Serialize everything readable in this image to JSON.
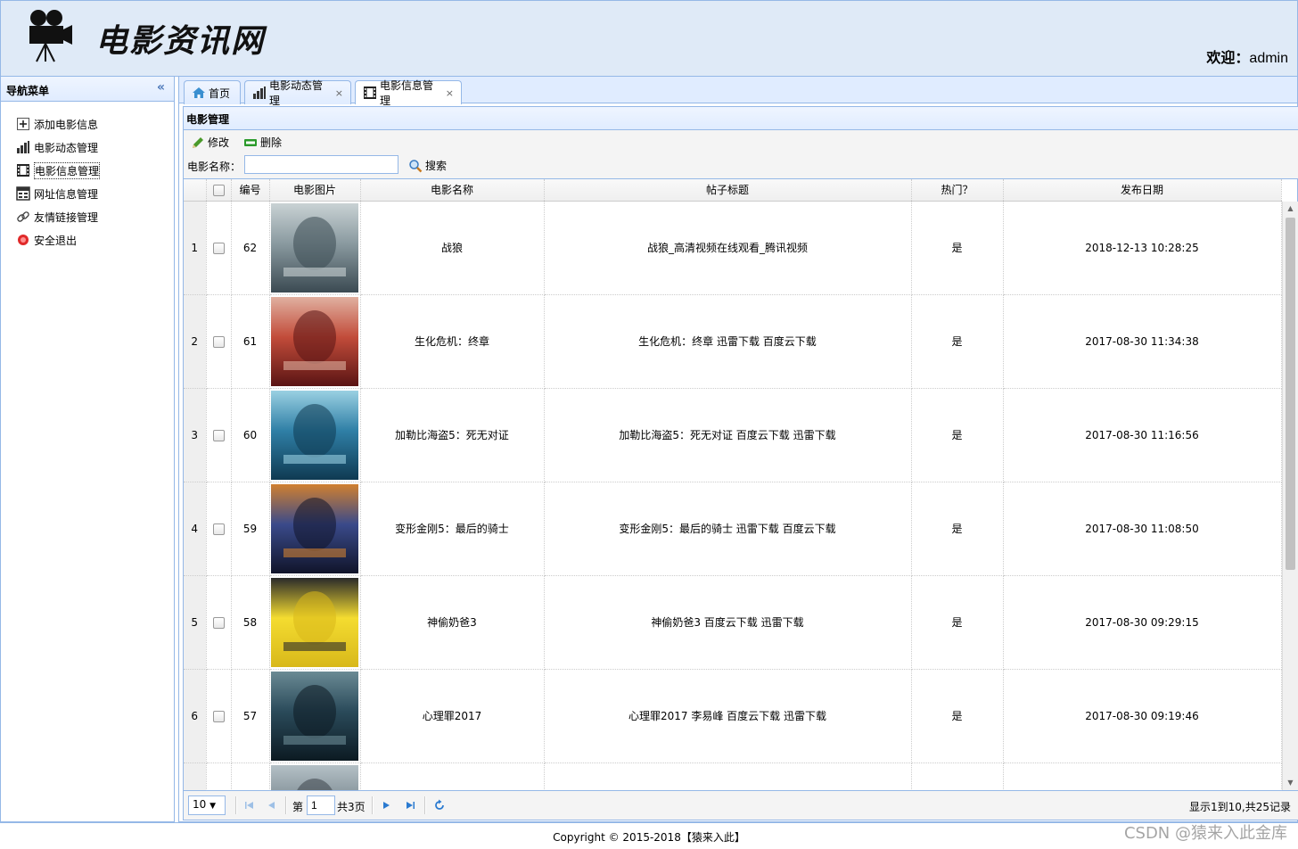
{
  "header": {
    "site_title": "电影资讯网",
    "welcome_label": "欢迎：",
    "username": "admin"
  },
  "sidebar": {
    "title": "导航菜单",
    "items": [
      {
        "label": "添加电影信息",
        "icon": "add-icon"
      },
      {
        "label": "电影动态管理",
        "icon": "bar-chart-icon"
      },
      {
        "label": "电影信息管理",
        "icon": "film-icon",
        "active": true
      },
      {
        "label": "网址信息管理",
        "icon": "window-icon"
      },
      {
        "label": "友情链接管理",
        "icon": "link-icon"
      },
      {
        "label": "安全退出",
        "icon": "exit-icon"
      }
    ]
  },
  "tabs": [
    {
      "label": "首页",
      "icon": "home-icon",
      "closable": false
    },
    {
      "label": "电影动态管理",
      "icon": "bar-chart-icon",
      "closable": true
    },
    {
      "label": "电影信息管理",
      "icon": "film-icon",
      "closable": true,
      "active": true
    }
  ],
  "panel": {
    "title": "电影管理",
    "edit_label": "修改",
    "delete_label": "删除",
    "search_label": "电影名称：",
    "search_value": "",
    "search_button": "搜索"
  },
  "grid": {
    "columns": [
      "编号",
      "电影图片",
      "电影名称",
      "帖子标题",
      "热门？",
      "发布日期"
    ],
    "rows": [
      {
        "rownum": "1",
        "id": "62",
        "name": "战狼",
        "title": "战狼_高清视频在线观看_腾讯视频",
        "hot": "是",
        "date": "2018-12-13 10:28:25",
        "poster": [
          "#3b4a52",
          "#8a9aa0",
          "#c9d2d4"
        ]
      },
      {
        "rownum": "2",
        "id": "61",
        "name": "生化危机：终章",
        "title": "生化危机：终章 迅雷下载 百度云下载",
        "hot": "是",
        "date": "2017-08-30 11:34:38",
        "poster": [
          "#5a1414",
          "#c24c3a",
          "#e0b0a0"
        ]
      },
      {
        "rownum": "3",
        "id": "60",
        "name": "加勒比海盗5：死无对证",
        "title": "加勒比海盗5：死无对证 百度云下载 迅雷下载",
        "hot": "是",
        "date": "2017-08-30 11:16:56",
        "poster": [
          "#0f3a52",
          "#2f7fa6",
          "#9ad0e2"
        ]
      },
      {
        "rownum": "4",
        "id": "59",
        "name": "变形金刚5：最后的骑士",
        "title": "变形金刚5：最后的骑士 迅雷下载 百度云下载",
        "hot": "是",
        "date": "2017-08-30 11:08:50",
        "poster": [
          "#10142a",
          "#3a4a8a",
          "#d08030"
        ]
      },
      {
        "rownum": "5",
        "id": "58",
        "name": "神偷奶爸3",
        "title": "神偷奶爸3 百度云下载 迅雷下载",
        "hot": "是",
        "date": "2017-08-30 09:29:15",
        "poster": [
          "#d8b81a",
          "#f4dc30",
          "#2a2a2a"
        ]
      },
      {
        "rownum": "6",
        "id": "57",
        "name": "心理罪2017",
        "title": "心理罪2017 李易峰 百度云下载 迅雷下载",
        "hot": "是",
        "date": "2017-08-30 09:19:46",
        "poster": [
          "#0c1a22",
          "#2a4a5a",
          "#6a8a94"
        ]
      },
      {
        "rownum": "",
        "id": "",
        "name": "",
        "title": "",
        "hot": "",
        "date": "",
        "poster": [
          "#3a4248",
          "#7a8890",
          "#b4c0c6"
        ]
      }
    ]
  },
  "pager": {
    "page_size": "10",
    "page_prefix": "第",
    "page_value": "1",
    "page_total": "共3页",
    "info": "显示1到10,共25记录"
  },
  "footer": {
    "copyright": "Copyright © 2015-2018【猿来入此】"
  },
  "watermark": "CSDN @猿来入此金库",
  "colors": {
    "border": "#95b8e7",
    "header_bg": "#dfeaf7",
    "panel_bg": "#e0ecff"
  }
}
